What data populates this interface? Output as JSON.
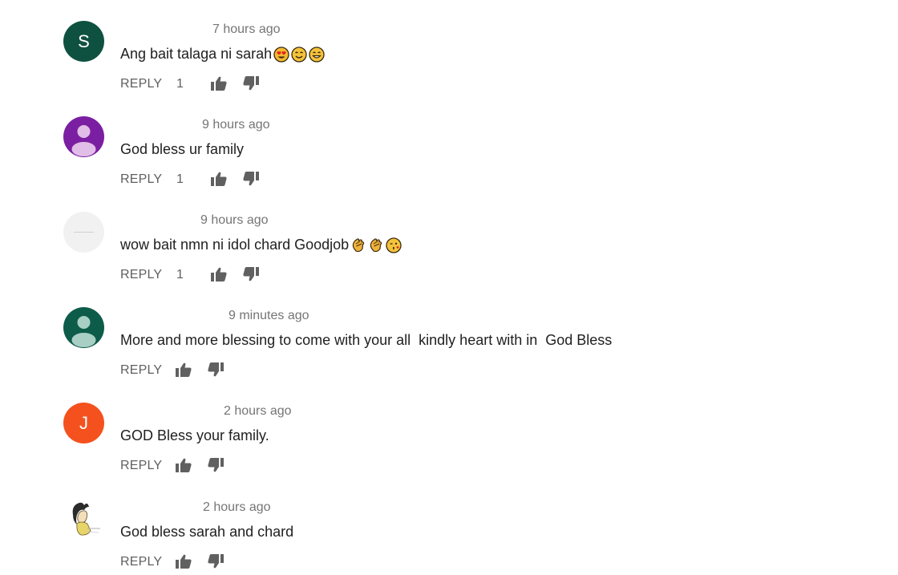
{
  "comments": [
    {
      "avatar_type": "letter",
      "avatar_letter": "S",
      "avatar_color": "#0f5140",
      "timestamp": "7 hours ago",
      "text": "Ang bait talaga ni sarah",
      "emojis": [
        "heart-eyes-emoji",
        "smiling-emoji",
        "grinning-emoji"
      ],
      "reply_label": "REPLY",
      "likes": "1"
    },
    {
      "avatar_type": "person",
      "avatar_color": "#7b1fa2",
      "avatar_figure_color": "#e1bee7",
      "timestamp": "9 hours ago",
      "text": "God bless ur family",
      "emojis": [],
      "reply_label": "REPLY",
      "likes": "1"
    },
    {
      "avatar_type": "blank",
      "avatar_color": "#f1f1f1",
      "timestamp": "9 hours ago",
      "text": "wow bait nmn ni idol chard Goodjob",
      "emojis": [
        "clapping-hands-emoji",
        "clapping-hands-emoji",
        "winking-kiss-emoji"
      ],
      "reply_label": "REPLY",
      "likes": "1"
    },
    {
      "avatar_type": "person",
      "avatar_color": "#0d5c4a",
      "avatar_figure_color": "#a9cfc5",
      "timestamp": "9 minutes ago",
      "text": "More and more blessing to come with your all  kindly heart with in  God Bless",
      "emojis": [],
      "reply_label": "REPLY",
      "likes": ""
    },
    {
      "avatar_type": "letter",
      "avatar_letter": "J",
      "avatar_color": "#f4511e",
      "timestamp": "2 hours ago",
      "text": "GOD Bless your family.",
      "emojis": [],
      "reply_label": "REPLY",
      "likes": ""
    },
    {
      "avatar_type": "cartoon",
      "avatar_color": "#ffffff",
      "timestamp": "2 hours ago",
      "text": "God bless sarah and chard",
      "emojis": [],
      "reply_label": "REPLY",
      "likes": ""
    }
  ]
}
